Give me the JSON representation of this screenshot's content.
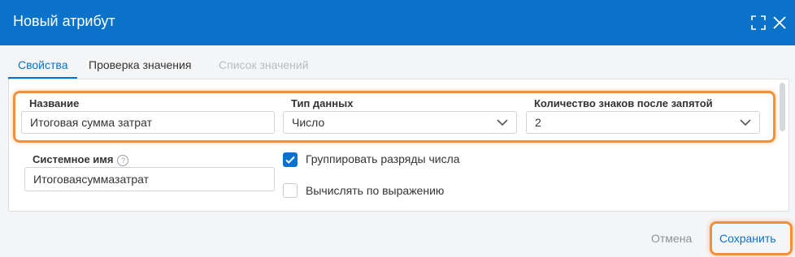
{
  "dialog": {
    "title": "Новый атрибут",
    "icons": {
      "maximize": "maximize-icon",
      "close": "close-icon"
    }
  },
  "tabs": [
    {
      "label": "Свойства",
      "state": "active"
    },
    {
      "label": "Проверка значения",
      "state": "normal"
    },
    {
      "label": "Список значений",
      "state": "disabled"
    }
  ],
  "form": {
    "name": {
      "label": "Название",
      "value": "Итоговая сумма затрат"
    },
    "data_type": {
      "label": "Тип данных",
      "value": "Число"
    },
    "decimals": {
      "label": "Количество знаков после запятой",
      "value": "2"
    },
    "system_name": {
      "label": "Системное имя",
      "value": "Итоговаясуммазатрат",
      "help_glyph": "?"
    },
    "group_digits": {
      "label": "Группировать разряды числа",
      "checked": true
    },
    "compute_expr": {
      "label": "Вычислять по выражению",
      "checked": false
    }
  },
  "footer": {
    "cancel_label": "Отмена",
    "save_label": "Сохранить"
  },
  "colors": {
    "accent": "#0a72c9",
    "highlight": "#f0913a"
  }
}
